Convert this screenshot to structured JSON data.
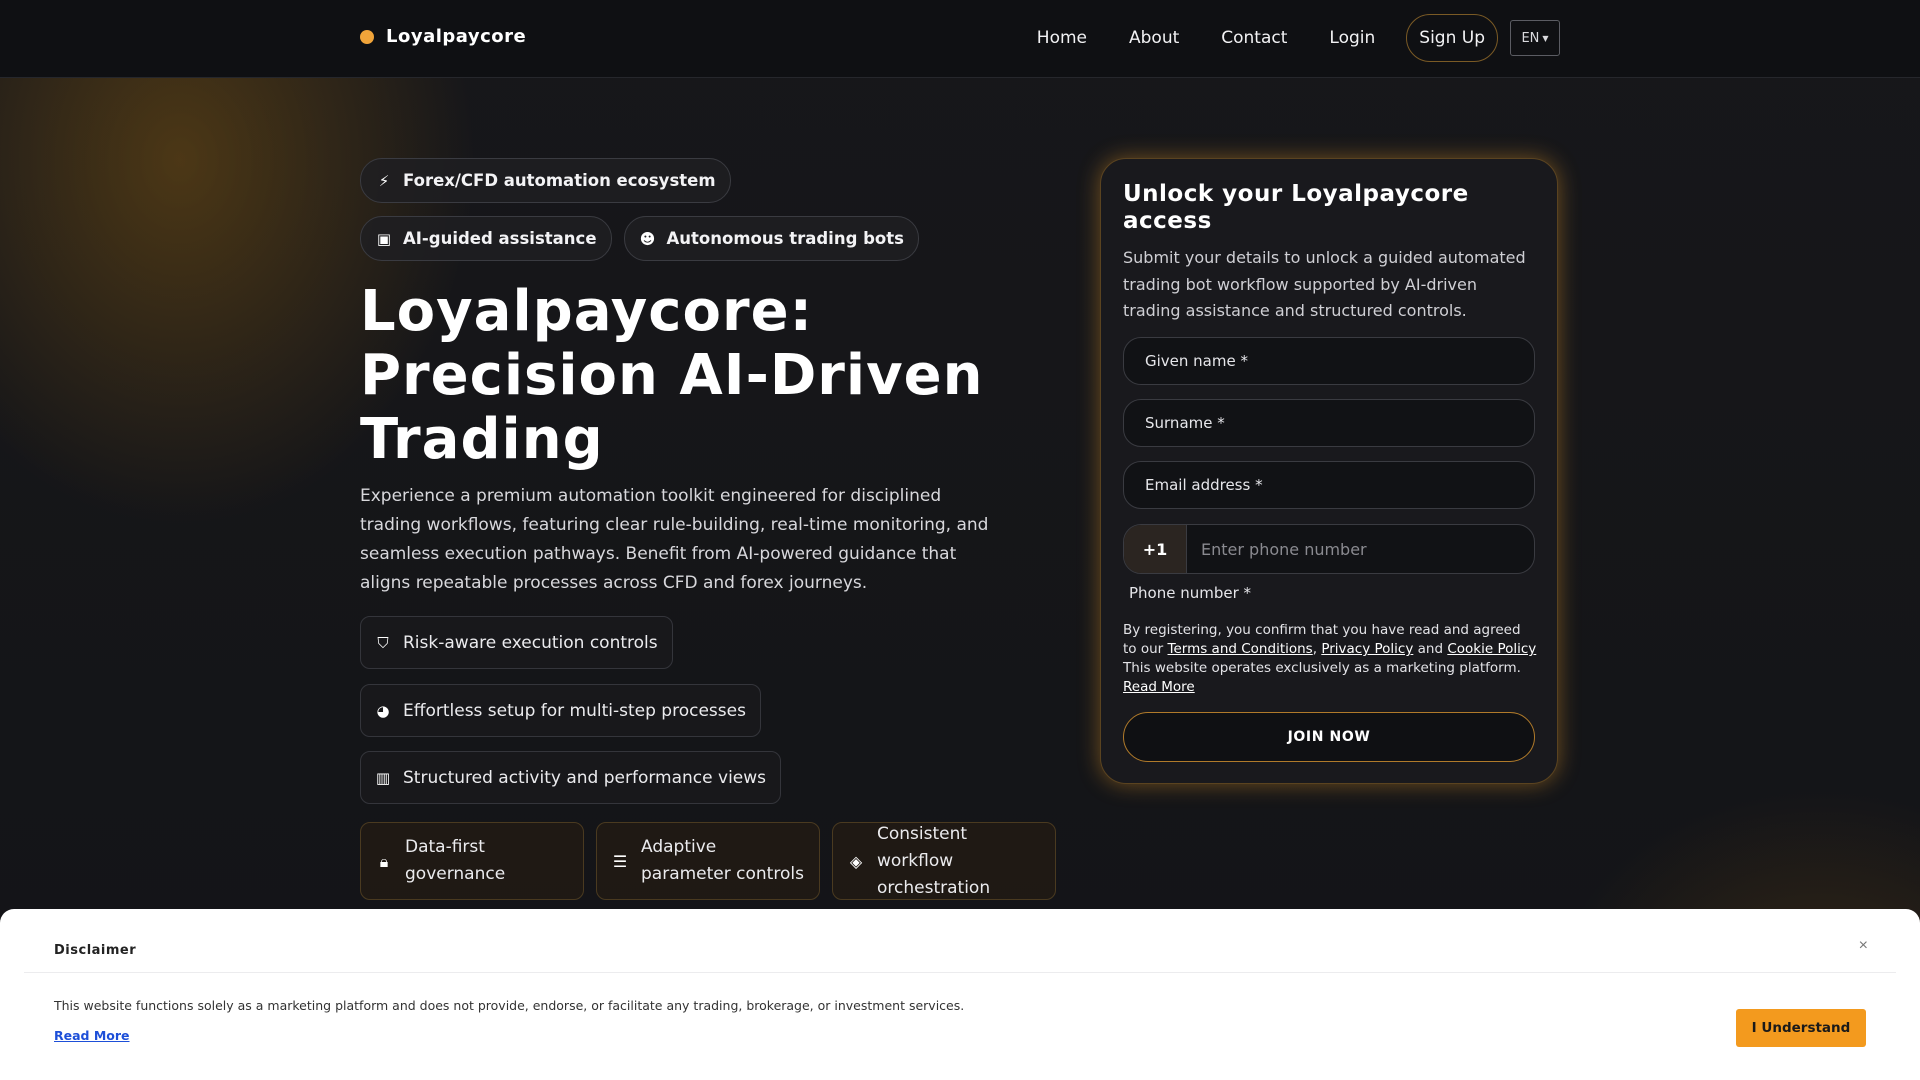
{
  "brand": {
    "name": "Loyalpaycore",
    "accent": "#f0a43a"
  },
  "nav": {
    "items": [
      "Home",
      "About",
      "Contact",
      "Login"
    ],
    "signup": "Sign Up",
    "language": "EN"
  },
  "hero": {
    "chips": [
      {
        "icon": "bolt-icon",
        "label": "Forex/CFD automation ecosystem"
      },
      {
        "icon": "chip-icon",
        "label": "AI-guided assistance"
      },
      {
        "icon": "robot-icon",
        "label": "Autonomous trading bots"
      }
    ],
    "title": "Loyalpaycore: Precision AI-Driven Trading",
    "description": "Experience a premium automation toolkit engineered for disciplined trading workflows, featuring clear rule-building, real-time monitoring, and seamless execution pathways. Benefit from AI-powered guidance that aligns repeatable processes across CFD and forex journeys.",
    "features": [
      {
        "icon": "shield-icon",
        "label": "Risk-aware execution controls"
      },
      {
        "icon": "palette-icon",
        "label": "Effortless setup for multi-step processes"
      },
      {
        "icon": "bar-chart-icon",
        "label": "Structured activity and performance views"
      }
    ],
    "tiles": [
      {
        "icon": "lock-icon",
        "label": "Data-first governance"
      },
      {
        "icon": "sliders-icon",
        "label": "Adaptive parameter controls"
      },
      {
        "icon": "layers-icon",
        "label": "Consistent workflow orchestration"
      }
    ]
  },
  "form": {
    "title": "Unlock your Loyalpaycore access",
    "subtitle": "Submit your details to unlock a guided automated trading bot workflow supported by AI-driven trading assistance and structured controls.",
    "given_name_label": "Given name *",
    "surname_label": "Surname *",
    "email_label": "Email address *",
    "phone_code": "+1",
    "phone_placeholder": "Enter phone number",
    "phone_label": "Phone number *",
    "legal_prefix": "By registering, you confirm that you have read and agreed to our",
    "terms_link": "Terms and Conditions",
    "comma": ",",
    "privacy_link": "Privacy Policy",
    "and_text": "and",
    "cookie_link": "Cookie Policy",
    "legal_suffix": "This website operates exclusively as a marketing platform.",
    "read_more_link": "Read More",
    "submit_label": "JOIN NOW"
  },
  "disclaimer": {
    "title": "Disclaimer",
    "close": "×",
    "text": "This website functions solely as a marketing platform and does not provide, endorse, or facilitate any trading, brokerage, or investment services.",
    "read_more": "Read More",
    "button": "I Understand",
    "button_color": "#f39a1e"
  }
}
